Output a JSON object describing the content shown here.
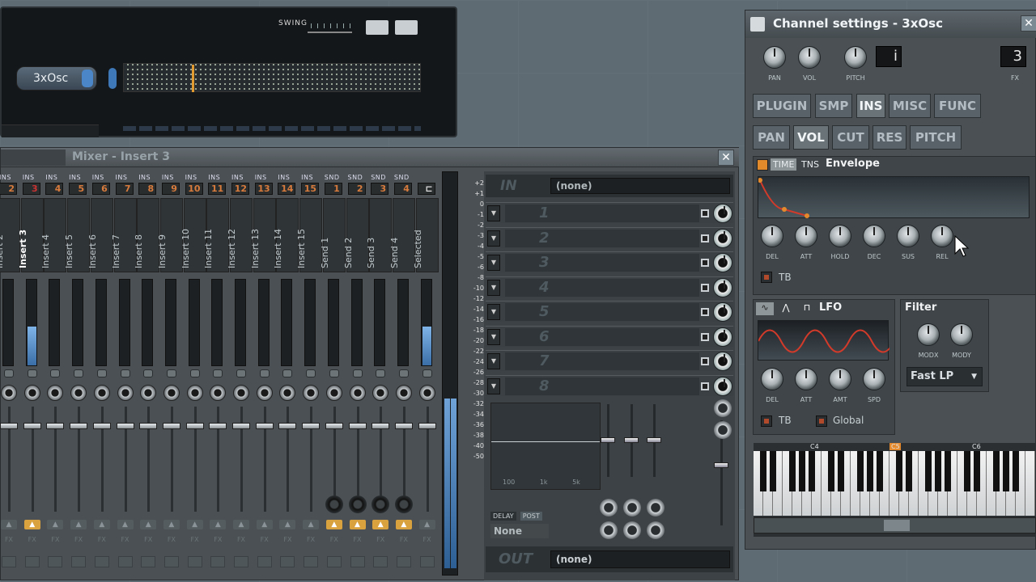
{
  "seq": {
    "swing_label": "SWING",
    "channel_name": "3xOsc"
  },
  "mixer": {
    "title": "Mixer - Insert 3",
    "close": "✕",
    "strips": [
      {
        "tag": "INS",
        "num": "2",
        "name": "Insert 2"
      },
      {
        "tag": "INS",
        "num": "3",
        "name": "Insert 3",
        "current": true
      },
      {
        "tag": "INS",
        "num": "4",
        "name": "Insert 4"
      },
      {
        "tag": "INS",
        "num": "5",
        "name": "Insert 5"
      },
      {
        "tag": "INS",
        "num": "6",
        "name": "Insert 6"
      },
      {
        "tag": "INS",
        "num": "7",
        "name": "Insert 7"
      },
      {
        "tag": "INS",
        "num": "8",
        "name": "Insert 8"
      },
      {
        "tag": "INS",
        "num": "9",
        "name": "Insert 9"
      },
      {
        "tag": "INS",
        "num": "10",
        "name": "Insert 10"
      },
      {
        "tag": "INS",
        "num": "11",
        "name": "Insert 11"
      },
      {
        "tag": "INS",
        "num": "12",
        "name": "Insert 12"
      },
      {
        "tag": "INS",
        "num": "13",
        "name": "Insert 13"
      },
      {
        "tag": "INS",
        "num": "14",
        "name": "Insert 14"
      },
      {
        "tag": "INS",
        "num": "15",
        "name": "Insert 15"
      },
      {
        "tag": "SND",
        "num": "1",
        "name": "Send 1"
      },
      {
        "tag": "SND",
        "num": "2",
        "name": "Send 2"
      },
      {
        "tag": "SND",
        "num": "3",
        "name": "Send 3"
      },
      {
        "tag": "SND",
        "num": "4",
        "name": "Send 4"
      },
      {
        "tag": "",
        "num": "",
        "name": "Selected"
      }
    ],
    "scale": [
      "+2",
      "+1",
      "0",
      "-1",
      "-2",
      "-3",
      "-4",
      "-5",
      "-6",
      "-8",
      "-10",
      "-12",
      "-14",
      "-16",
      "-18",
      "-20",
      "-22",
      "-24",
      "-26",
      "-28",
      "-30",
      "-32",
      "-34",
      "-36",
      "-38",
      "-40",
      "-50"
    ],
    "in_label": "IN",
    "in_value": "(none)",
    "slots": [
      "1",
      "2",
      "3",
      "4",
      "5",
      "6",
      "7",
      "8"
    ],
    "eq_labels": "100 1k 5k",
    "delay_label": "DELAY",
    "post_label": "POST",
    "delay_value": "None",
    "out_label": "OUT",
    "out_value": "(none)"
  },
  "channel": {
    "title": "Channel settings - 3xOsc",
    "close": "✕",
    "knob_labels": [
      "PAN",
      "VOL",
      "PITCH"
    ],
    "lcd1": "i",
    "fx_label": "FX",
    "fx_value": "3",
    "tabs": [
      "PLUGIN",
      "SMP",
      "INS",
      "MISC",
      "FUNC"
    ],
    "subtabs": [
      "PAN",
      "VOL",
      "CUT",
      "RES",
      "PITCH"
    ],
    "env_tabs": [
      "TIME",
      "TNS"
    ],
    "env_title": "Envelope",
    "env_knobs": [
      "DEL",
      "ATT",
      "HOLD",
      "DEC",
      "SUS",
      "REL"
    ],
    "tb_label": "TB",
    "lfo_title": "LFO",
    "lfo_knobs": [
      "DEL",
      "ATT",
      "AMT",
      "SPD"
    ],
    "global_label": "Global",
    "filter_title": "Filter",
    "filter_knobs": [
      "MODX",
      "MODY"
    ],
    "filter_type": "Fast LP",
    "octaves": [
      "C4",
      "C5",
      "C6"
    ]
  }
}
